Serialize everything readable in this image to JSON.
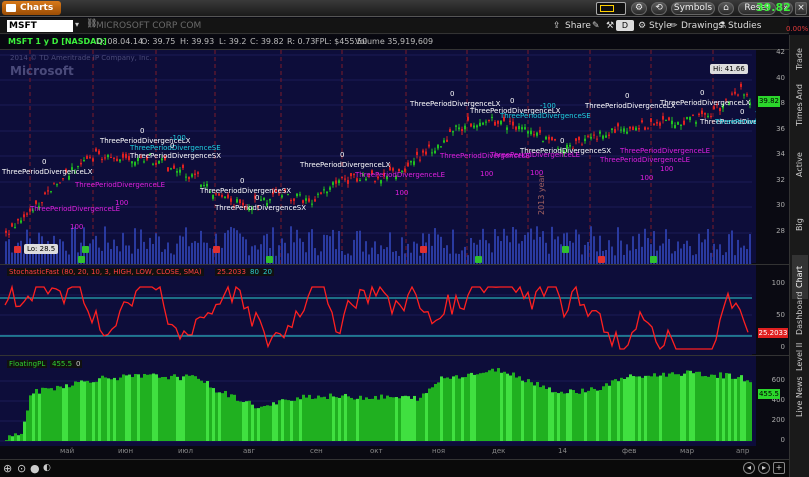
{
  "titlebar": {
    "app_title": "Charts",
    "symbols_label": "Symbols",
    "reset_label": "Reset"
  },
  "toolbar": {
    "symbol": "MSFT",
    "company": "MICROSOFT CORP COM",
    "share_label": "Share",
    "style_label": "Style",
    "drawings_label": "Drawings",
    "studies_label": "Studies",
    "d_label": "D",
    "last_price": "39.82",
    "pct_change": "0.00%"
  },
  "infobar": {
    "title": "MSFT 1 y D [NASDAQ]",
    "date": "D: 08.04.14",
    "open": "O: 39.75",
    "high": "H: 39.93",
    "low": "L: 39.2",
    "close": "C: 39.82",
    "range": "R: 0.73",
    "fpl": "FPL: $455.50",
    "volume": "Volume 35,919,609"
  },
  "watermark": {
    "line1": "2014 © TD Ameritrade IP Company, Inc.",
    "line2": "Microsoft"
  },
  "price_pane": {
    "axis_labels": [
      "42",
      "40",
      "38",
      "36",
      "34",
      "32",
      "30",
      "28"
    ],
    "hi_label": "Hi: 41.66",
    "lo_label": "Lo: 28.5",
    "last_badge": "39.82",
    "period_labels": [
      "2013 year"
    ],
    "signals": [
      {
        "text": "ThreePeriodDivergenceLX",
        "qty": "0"
      },
      {
        "text": "ThreePeriodDivergenceLE",
        "qty": "100"
      },
      {
        "text": "ThreePeriodDivergenceSE",
        "qty": "-100"
      },
      {
        "text": "ThreePeriodDivergenceSX",
        "qty": "0"
      }
    ]
  },
  "stoch_pane": {
    "title": "StochasticFast (80, 20, 10, 3, HIGH, LOW, CLOSE, SMA)",
    "value": "25.2033",
    "ob": "80",
    "os": "20",
    "axis_labels": [
      "100",
      "50",
      "0"
    ],
    "value_badge": "25.2033"
  },
  "fpl_pane": {
    "title": "FloatingPL",
    "value": "455.5",
    "zero": "0",
    "axis_labels": [
      "600",
      "400",
      "200",
      "0"
    ],
    "value_badge": "455.5"
  },
  "months": [
    "май",
    "июн",
    "июл",
    "авг",
    "сен",
    "окт",
    "ноя",
    "дек",
    "14",
    "фев",
    "мар",
    "апр"
  ],
  "sidebar": [
    "Trade",
    "Times And Sales",
    "Active Trader",
    "Big Buttons",
    "Chart",
    "Dashboard",
    "Level II",
    "Live News"
  ],
  "colors": {
    "bg": "#0d0d3a",
    "up": "#20c020",
    "down": "#e02020",
    "stoch": "#ff2020",
    "fpl": "#20b020"
  }
}
